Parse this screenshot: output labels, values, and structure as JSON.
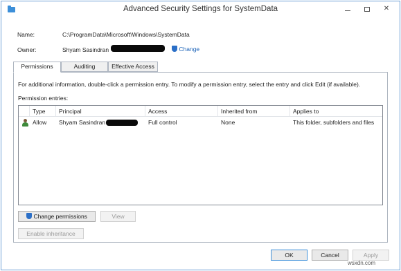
{
  "window": {
    "title": "Advanced Security Settings for SystemData",
    "controls": {
      "minimize": "–",
      "maximize": "",
      "close": "✕"
    }
  },
  "info": {
    "name_label": "Name:",
    "name_value": "C:\\ProgramData\\Microsoft\\Windows\\SystemData",
    "owner_label": "Owner:",
    "owner_value": "Shyam Sasindran",
    "change_link": "Change"
  },
  "tabs": [
    {
      "label": "Permissions",
      "active": true
    },
    {
      "label": "Auditing",
      "active": false
    },
    {
      "label": "Effective Access",
      "active": false
    }
  ],
  "permissions_panel": {
    "help_text": "For additional information, double-click a permission entry. To modify a permission entry, select the entry and click Edit (if available).",
    "entries_label": "Permission entries:",
    "columns": [
      "Type",
      "Principal",
      "Access",
      "Inherited from",
      "Applies to"
    ],
    "rows": [
      {
        "type": "Allow",
        "principal": "Shyam Sasindran (",
        "access": "Full control",
        "inherited_from": "None",
        "applies_to": "This folder, subfolders and files"
      }
    ]
  },
  "buttons": {
    "change_permissions": "Change permissions",
    "view": "View",
    "enable_inheritance": "Enable inheritance",
    "ok": "OK",
    "cancel": "Cancel",
    "apply": "Apply"
  },
  "watermark": "wsxdn.com",
  "colors": {
    "link": "#1a62b8",
    "shield": "#2b6fc7",
    "window_border": "#6d9fd6"
  }
}
